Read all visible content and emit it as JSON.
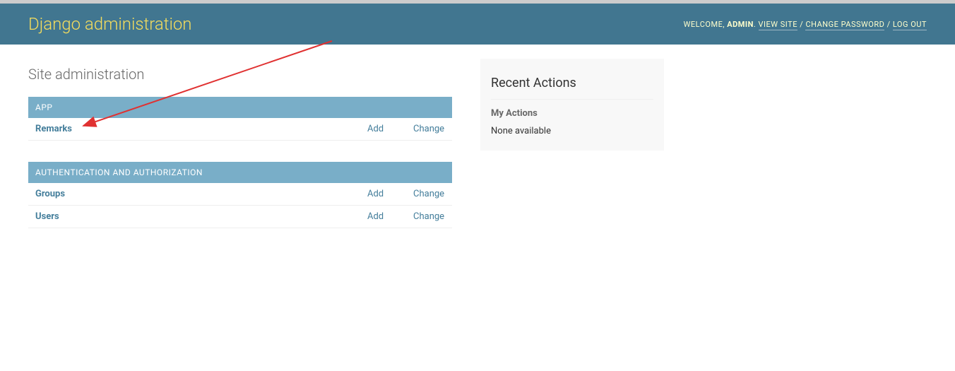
{
  "header": {
    "branding": "Django administration",
    "welcome": "WELCOME,",
    "username": "ADMIN",
    "view_site": "VIEW SITE",
    "change_password": "CHANGE PASSWORD",
    "log_out": "LOG OUT"
  },
  "page_title": "Site administration",
  "modules": [
    {
      "caption": "APP",
      "rows": [
        {
          "name": "Remarks",
          "add": "Add",
          "change": "Change"
        }
      ]
    },
    {
      "caption": "AUTHENTICATION AND AUTHORIZATION",
      "rows": [
        {
          "name": "Groups",
          "add": "Add",
          "change": "Change"
        },
        {
          "name": "Users",
          "add": "Add",
          "change": "Change"
        }
      ]
    }
  ],
  "recent": {
    "title": "Recent Actions",
    "subtitle": "My Actions",
    "empty": "None available"
  }
}
